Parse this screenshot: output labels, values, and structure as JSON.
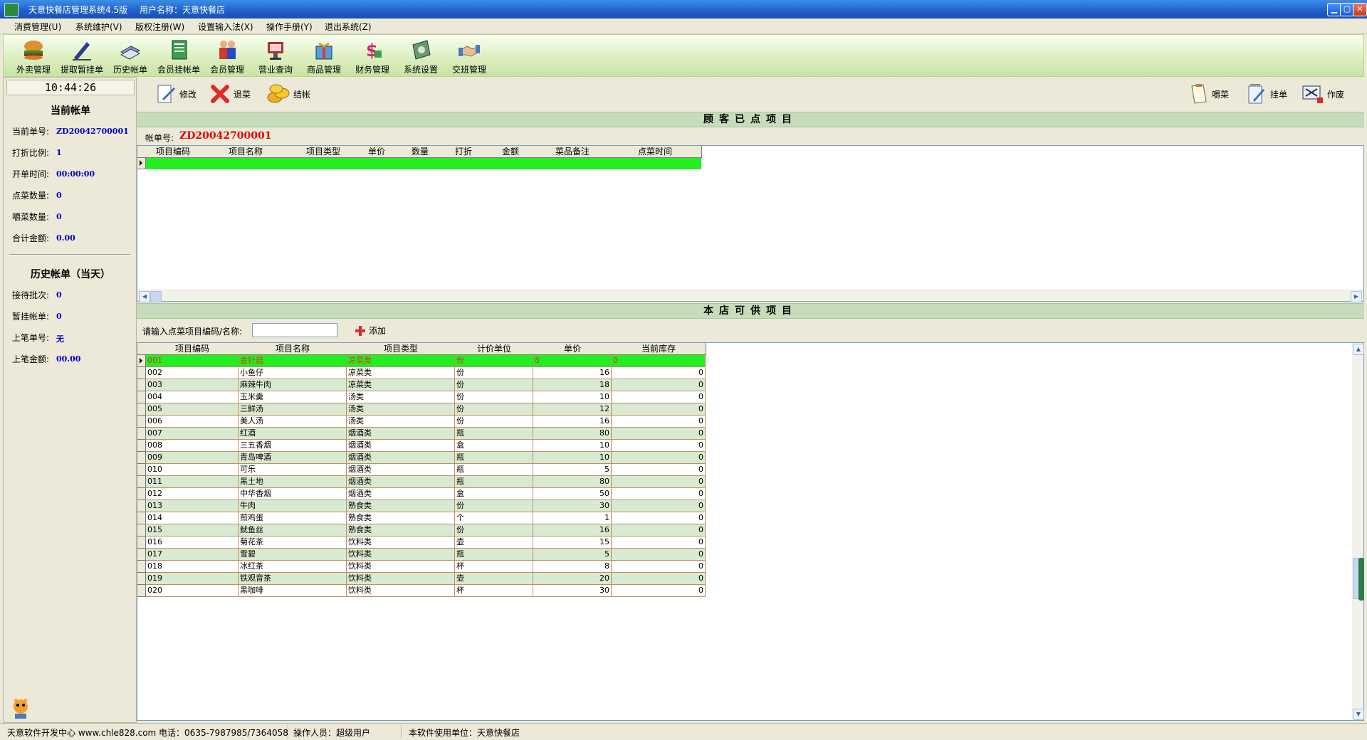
{
  "titlebar": {
    "title": "天意快餐店管理系统4.5版",
    "user": "用户名称：天意快餐店"
  },
  "menu": [
    "消费管理(U)",
    "系统维护(V)",
    "版权注册(W)",
    "设置输入法(X)",
    "操作手册(Y)",
    "退出系统(Z)"
  ],
  "toolbar": [
    {
      "label": "外卖管理",
      "icon": "burger-icon"
    },
    {
      "label": "提取暂挂单",
      "icon": "pen-icon"
    },
    {
      "label": "历史帐单",
      "icon": "books-icon"
    },
    {
      "label": "会员挂帐单",
      "icon": "notebook-icon"
    },
    {
      "label": "会员管理",
      "icon": "members-icon"
    },
    {
      "label": "营业查询",
      "icon": "query-icon"
    },
    {
      "label": "商品管理",
      "icon": "gift-icon"
    },
    {
      "label": "财务管理",
      "icon": "money-icon"
    },
    {
      "label": "系统设置",
      "icon": "settings-icon"
    },
    {
      "label": "交班管理",
      "icon": "handshake-icon"
    }
  ],
  "left": {
    "clock": "10:44:26",
    "current_title": "当前帐单",
    "current": [
      {
        "label": "当前单号:",
        "value": "ZD20042700001"
      },
      {
        "label": "打折比例:",
        "value": "1"
      },
      {
        "label": "开单时间:",
        "value": "00:00:00"
      },
      {
        "label": "点菜数量:",
        "value": "0"
      },
      {
        "label": "嚼菜数量:",
        "value": "0"
      },
      {
        "label": "合计金额:",
        "value": "0.00"
      }
    ],
    "history_title": "历史帐单（当天）",
    "history": [
      {
        "label": "接待批次:",
        "value": "0"
      },
      {
        "label": "暂挂帐单:",
        "value": "0"
      },
      {
        "label": "上笔单号:",
        "value": "无"
      },
      {
        "label": "上笔金额:",
        "value": "00.00"
      }
    ]
  },
  "actions": {
    "modify": "修改",
    "return": "退菜",
    "checkout": "结帐",
    "chew": "嚼菜",
    "hold": "挂单",
    "void": "作废"
  },
  "ordered": {
    "section_title": "顾客已点项目",
    "bill_label": "帐单号:",
    "bill_no": "ZD20042700001",
    "headers": [
      "项目编码",
      "项目名称",
      "项目类型",
      "单价",
      "数量",
      "打折",
      "金额",
      "菜品备注",
      "点菜时间"
    ]
  },
  "available": {
    "section_title": "本店可供项目",
    "search_label": "请输入点菜项目编码/名称:",
    "search_value": "",
    "add_label": "添加",
    "headers": [
      "项目编码",
      "项目名称",
      "项目类型",
      "计价单位",
      "单价",
      "当前库存"
    ],
    "rows": [
      [
        "001",
        "金针菇",
        "凉菜类",
        "份",
        "8",
        "0"
      ],
      [
        "002",
        "小鱼仔",
        "凉菜类",
        "份",
        "16",
        "0"
      ],
      [
        "003",
        "麻辣牛肉",
        "凉菜类",
        "份",
        "18",
        "0"
      ],
      [
        "004",
        "玉米羹",
        "汤类",
        "份",
        "10",
        "0"
      ],
      [
        "005",
        "三鲜汤",
        "汤类",
        "份",
        "12",
        "0"
      ],
      [
        "006",
        "美人汤",
        "汤类",
        "份",
        "16",
        "0"
      ],
      [
        "007",
        "红酒",
        "烟酒类",
        "瓶",
        "80",
        "0"
      ],
      [
        "008",
        "三五香烟",
        "烟酒类",
        "盒",
        "10",
        "0"
      ],
      [
        "009",
        "青岛啤酒",
        "烟酒类",
        "瓶",
        "10",
        "0"
      ],
      [
        "010",
        "可乐",
        "烟酒类",
        "瓶",
        "5",
        "0"
      ],
      [
        "011",
        "黑土地",
        "烟酒类",
        "瓶",
        "80",
        "0"
      ],
      [
        "012",
        "中华香烟",
        "烟酒类",
        "盒",
        "50",
        "0"
      ],
      [
        "013",
        "牛肉",
        "熟食类",
        "份",
        "30",
        "0"
      ],
      [
        "014",
        "煎鸡蛋",
        "熟食类",
        "个",
        "1",
        "0"
      ],
      [
        "015",
        "鱿鱼丝",
        "熟食类",
        "份",
        "16",
        "0"
      ],
      [
        "016",
        "菊花茶",
        "饮料类",
        "壶",
        "15",
        "0"
      ],
      [
        "017",
        "雪碧",
        "饮料类",
        "瓶",
        "5",
        "0"
      ],
      [
        "018",
        "冰红茶",
        "饮料类",
        "杯",
        "8",
        "0"
      ],
      [
        "019",
        "铁观音茶",
        "饮料类",
        "壶",
        "20",
        "0"
      ],
      [
        "020",
        "黑咖啡",
        "饮料类",
        "杯",
        "30",
        "0"
      ]
    ]
  },
  "status": {
    "developer": "天意软件开发中心 www.chle828.com 电话：0635-7987985/7364058",
    "operator": "操作人员：超级用户",
    "licensee": "本软件使用单位：天意快餐店"
  },
  "colors": {
    "selected_row": "#22ee22",
    "alt_row": "#d8ead2",
    "section_bg": "#c6dcbc",
    "toolbar_bg": "#dff0c4",
    "value_blue": "#0000c8",
    "bill_red": "#e00000"
  }
}
